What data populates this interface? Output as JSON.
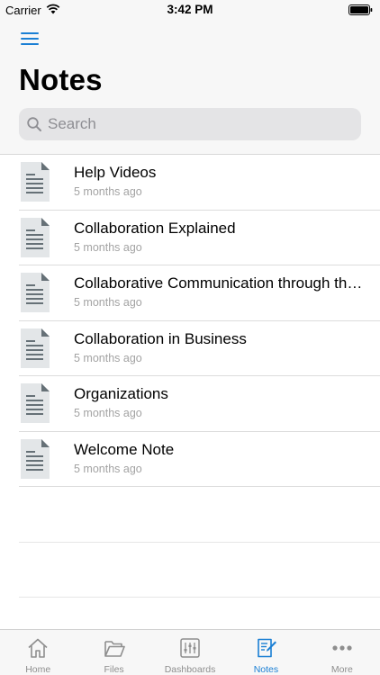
{
  "status_bar": {
    "carrier": "Carrier",
    "time": "3:42 PM"
  },
  "header": {
    "title": "Notes",
    "menu_icon": "hamburger-menu-icon"
  },
  "search": {
    "placeholder": "Search"
  },
  "notes": [
    {
      "title": "Help Videos",
      "time": "5 months ago"
    },
    {
      "title": "Collaboration Explained",
      "time": "5 months ago"
    },
    {
      "title": "Collaborative Communication through the Cloud",
      "time": "5 months ago"
    },
    {
      "title": "Collaboration in Business",
      "time": "5 months ago"
    },
    {
      "title": "Organizations",
      "time": "5 months ago"
    },
    {
      "title": "Welcome Note",
      "time": "5 months ago"
    }
  ],
  "tabs": [
    {
      "label": "Home",
      "icon": "home-icon",
      "active": false
    },
    {
      "label": "Files",
      "icon": "folder-icon",
      "active": false
    },
    {
      "label": "Dashboards",
      "icon": "dashboard-icon",
      "active": false
    },
    {
      "label": "Notes",
      "icon": "note-icon",
      "active": true
    },
    {
      "label": "More",
      "icon": "more-icon",
      "active": false
    }
  ],
  "colors": {
    "accent": "#1a7fd4",
    "inactive": "#8e8e8e",
    "secondary_text": "#a3a3a3"
  }
}
